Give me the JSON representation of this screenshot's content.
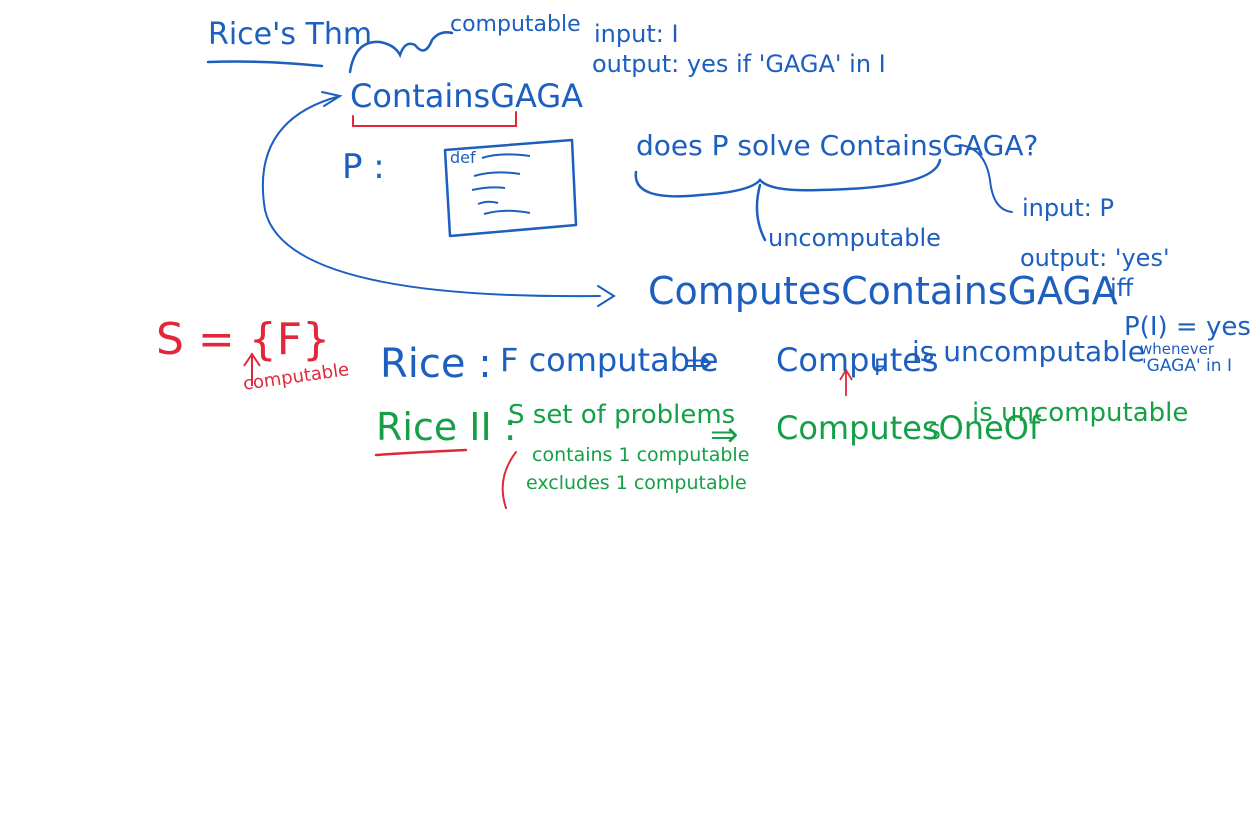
{
  "colors": {
    "blue": "#1d5fbf",
    "red": "#e0283a",
    "green": "#15a047",
    "background": "#ffffff"
  },
  "notes": {
    "title": "Rice's Thm",
    "computable_top": "computable",
    "input_I": "input: I",
    "output_yes_gaga": "output: yes if 'GAGA' in I",
    "contains_gaga": "ContainsGAGA",
    "p_label": "P :",
    "code_def": "def",
    "question": "does P solve ContainsGAGA?",
    "uncomputable_mid": "uncomputable",
    "computes_contains_gaga": "ComputesContainsGAGA",
    "input_P": "input: P",
    "output_yes": "output: 'yes'",
    "iff": "iff",
    "p_of_i": "P(I) = yes",
    "whenever": "whenever",
    "gaga_in_i": "'GAGA' in I",
    "s_def": "S = {F}",
    "computable_red": "computable",
    "rice": "Rice :",
    "f_computable": "F computable",
    "implies1": "⇒",
    "computes": "Computes",
    "computes_sub": "F",
    "is_uncomputable1": "is uncomputable",
    "rice_ii": "Rice II :",
    "s_set": "S set of problems",
    "contains_computable": "contains 1 computable",
    "excludes_computable": "excludes 1 computable",
    "implies2": "⇒",
    "computes_one_of": "ComputesOneOf",
    "computes_one_of_sub": "S",
    "is_uncomputable2": "is uncomputable"
  }
}
